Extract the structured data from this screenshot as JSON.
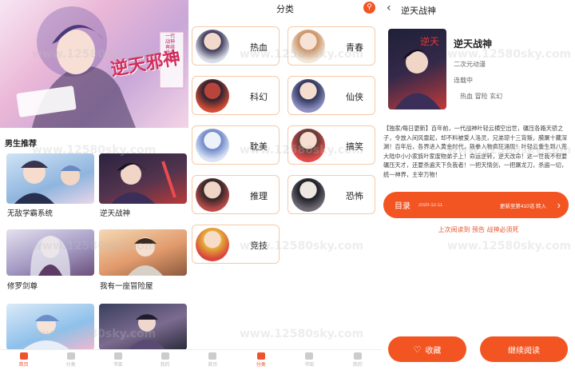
{
  "home": {
    "banner": {
      "title": "逆天邪神",
      "caption": "一代战神再续传奇（下）"
    },
    "section_title": "男生推荐",
    "cards": [
      {
        "title": "无敌学霸系统"
      },
      {
        "title": "逆天战神"
      },
      {
        "title": "修罗剑尊"
      },
      {
        "title": "我有一座冒险屋"
      },
      {
        "title": ""
      },
      {
        "title": ""
      }
    ],
    "tabs": [
      {
        "label": "首页",
        "active": true
      },
      {
        "label": "分类",
        "active": false
      },
      {
        "label": "书架",
        "active": false
      },
      {
        "label": "我的",
        "active": false
      }
    ]
  },
  "categories": {
    "header": "分类",
    "items": [
      {
        "label": "热血"
      },
      {
        "label": "青春"
      },
      {
        "label": "科幻"
      },
      {
        "label": "仙侠"
      },
      {
        "label": "耽美"
      },
      {
        "label": "搞笑"
      },
      {
        "label": "推理"
      },
      {
        "label": "恐怖"
      },
      {
        "label": "竞技"
      }
    ],
    "tabs": [
      {
        "label": "首页",
        "active": false
      },
      {
        "label": "分类",
        "active": true
      },
      {
        "label": "书架",
        "active": false
      },
      {
        "label": "我的",
        "active": false
      }
    ]
  },
  "detail": {
    "header_title": "逆天战神",
    "title": "逆天战神",
    "type": "二次元动漫",
    "status": "连载中",
    "tags": "热血 冒险 玄幻",
    "description": "【独家/每日更新】百年前，一代战神叶轻云横空出世，碾压各路天骄之子，令放入间风雷起，却不料被爱人洛灵，兄弟琼十三背叛，膜屠十藏深渊！百年后，各界进入黄金时代，轶拳人物疯狂涌现！叶轻云重生到八荒大陆中小小家族叶家废物弟子上！命运逆转，逆天改命！这一世我不但要碾压天才，还要杀遍天下负我者！一把天情剑，一把屠龙刀，杀遍一切，统一神界，主宰万物！",
    "catalog_label": "目录",
    "catalog_date": "2020-12-11",
    "catalog_update": "更新至第410话 转入",
    "last_read": "上次阅读到 预告 战神必须死",
    "favorite_label": "收藏",
    "continue_label": "继续阅读"
  },
  "watermark": "www.12580sky.com",
  "colors": {
    "accent": "#f35522",
    "tab_active": "#f0522e",
    "cat_border": "#f6c9a8",
    "last_read": "#e8552e"
  }
}
